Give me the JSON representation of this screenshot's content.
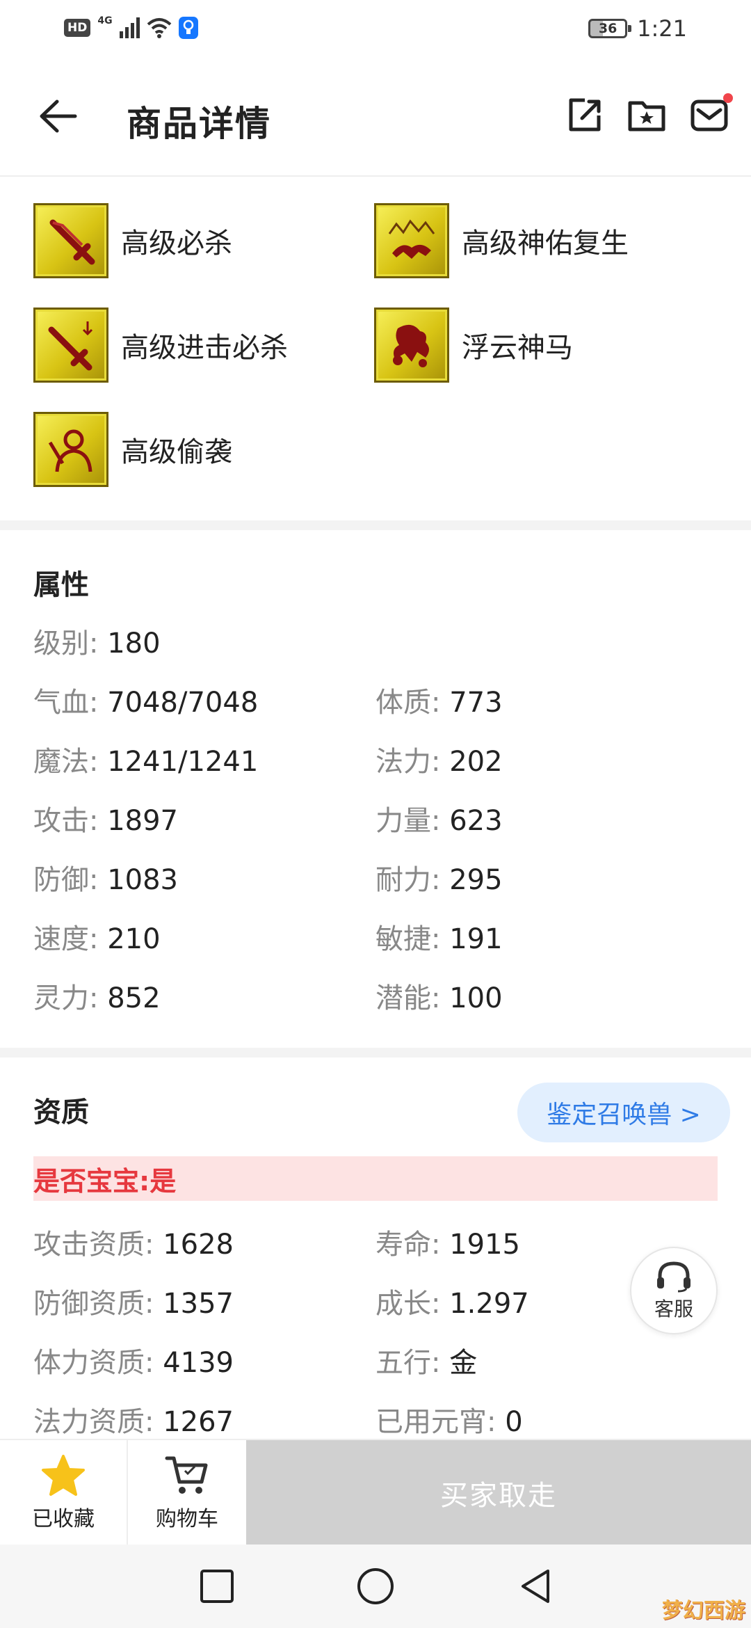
{
  "status_bar": {
    "hd": "HD",
    "network": "4G",
    "battery": "36",
    "time": "1:21"
  },
  "header": {
    "title": "商品详情",
    "icons": [
      "back-icon",
      "share-icon",
      "favorite-folder-icon",
      "message-icon"
    ]
  },
  "skills": [
    {
      "name": "高级必杀",
      "icon": "sword-icon"
    },
    {
      "name": "高级神佑复生",
      "icon": "horse-mountain-icon"
    },
    {
      "name": "高级进击必杀",
      "icon": "sword-arrow-icon"
    },
    {
      "name": "浮云神马",
      "icon": "cloud-horse-icon"
    },
    {
      "name": "高级偷袭",
      "icon": "stealth-figure-icon"
    }
  ],
  "attributes": {
    "title": "属性",
    "level": {
      "label": "级别:",
      "value": "180"
    },
    "rows": [
      {
        "left": {
          "label": "气血:",
          "value": "7048/7048"
        },
        "right": {
          "label": "体质:",
          "value": "773"
        }
      },
      {
        "left": {
          "label": "魔法:",
          "value": "1241/1241"
        },
        "right": {
          "label": "法力:",
          "value": "202"
        }
      },
      {
        "left": {
          "label": "攻击:",
          "value": "1897"
        },
        "right": {
          "label": "力量:",
          "value": "623"
        }
      },
      {
        "left": {
          "label": "防御:",
          "value": "1083"
        },
        "right": {
          "label": "耐力:",
          "value": "295"
        }
      },
      {
        "left": {
          "label": "速度:",
          "value": "210"
        },
        "right": {
          "label": "敏捷:",
          "value": "191"
        }
      },
      {
        "left": {
          "label": "灵力:",
          "value": "852"
        },
        "right": {
          "label": "潜能:",
          "value": "100"
        }
      }
    ]
  },
  "aptitude": {
    "title": "资质",
    "identify_button": "鉴定召唤兽 >",
    "baby": "是否宝宝:是",
    "rows": [
      {
        "left": {
          "label": "攻击资质:",
          "value": "1628"
        },
        "right": {
          "label": "寿命:",
          "value": "1915"
        }
      },
      {
        "left": {
          "label": "防御资质:",
          "value": "1357"
        },
        "right": {
          "label": "成长:",
          "value": "1.297"
        }
      },
      {
        "left": {
          "label": "体力资质:",
          "value": "4139"
        },
        "right": {
          "label": "五行:",
          "value": "金"
        }
      },
      {
        "left": {
          "label": "法力资质:",
          "value": "1267"
        },
        "right": {
          "label": "已用元宵:",
          "value": "0"
        }
      }
    ]
  },
  "customer_service": {
    "label": "客服"
  },
  "bottom_bar": {
    "favorite": "已收藏",
    "cart": "购物车",
    "buy": "买家取走"
  },
  "colors": {
    "accent_blue": "#2f7be6",
    "baby_red": "#e6383e",
    "star_yellow": "#f7c21a",
    "disabled_gray": "#d0d0d0"
  },
  "watermark": "梦幻西游"
}
